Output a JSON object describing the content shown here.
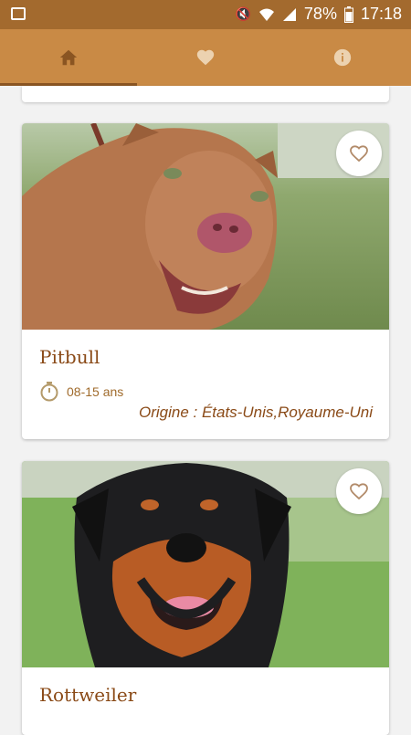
{
  "status_bar": {
    "battery": "78%",
    "time": "17:18"
  },
  "tabs": [
    {
      "name": "home",
      "active": true
    },
    {
      "name": "favorites",
      "active": false
    },
    {
      "name": "info",
      "active": false
    }
  ],
  "dogs": [
    {
      "name": "Pitbull",
      "lifespan": "08-15 ans",
      "origin": "Origine : États-Unis,Royaume-Uni"
    },
    {
      "name": "Rottweiler"
    }
  ],
  "colors": {
    "status_bar": "#a36a2e",
    "tab_bar": "#c98a45",
    "accent_text": "#8a4a17"
  }
}
